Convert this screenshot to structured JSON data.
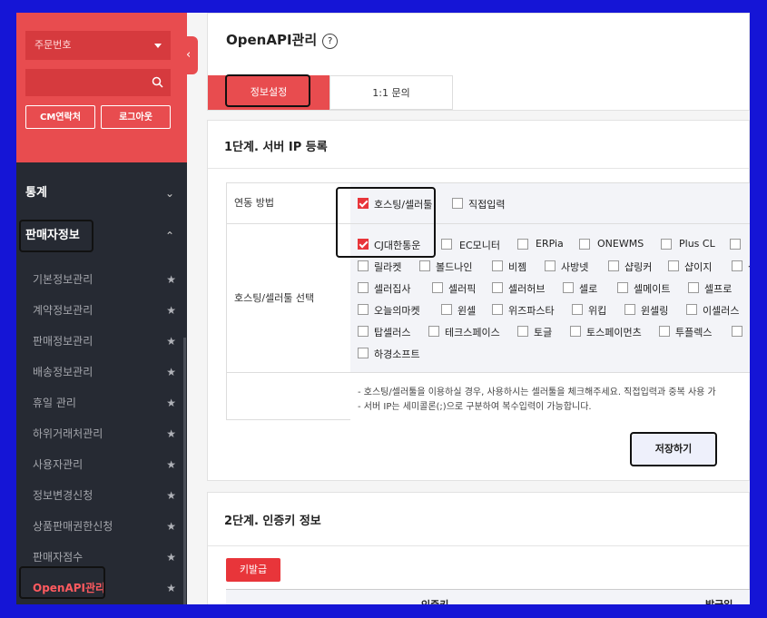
{
  "sidebar": {
    "select_label": "주문번호",
    "contact_button": "CM연락처",
    "logout_button": "로그아웃",
    "sections": [
      {
        "label": "통계",
        "expanded": false
      },
      {
        "label": "판매자정보",
        "expanded": true
      }
    ],
    "items": [
      {
        "label": "기본정보관리"
      },
      {
        "label": "계약정보관리"
      },
      {
        "label": "판매정보관리"
      },
      {
        "label": "배송정보관리"
      },
      {
        "label": "휴일 관리"
      },
      {
        "label": "하위거래처관리"
      },
      {
        "label": "사용자관리"
      },
      {
        "label": "정보변경신청"
      },
      {
        "label": "상품판매권한신청"
      },
      {
        "label": "판매자점수"
      },
      {
        "label": "OpenAPI관리",
        "active": true
      }
    ]
  },
  "header": {
    "title": "OpenAPI관리",
    "help_symbol": "?"
  },
  "tabs": [
    {
      "label": "정보설정",
      "active": true
    },
    {
      "label": "1:1 문의",
      "active": false
    }
  ],
  "step1": {
    "title": "1단계. 서버 IP 등록",
    "link_method_label": "연동 방법",
    "link_methods": [
      {
        "label": "호스팅/셀러툴",
        "checked": true
      },
      {
        "label": "직접입력",
        "checked": false
      }
    ],
    "select_label": "호스팅/셀러툴 선택",
    "tools": [
      [
        {
          "label": "CJ대한통운",
          "checked": true
        },
        {
          "label": "EC모니터"
        },
        {
          "label": "ERPia"
        },
        {
          "label": "ONEWMS"
        },
        {
          "label": "Plus CL"
        },
        {
          "label": "ㅂ"
        }
      ],
      [
        {
          "label": "릴라켓"
        },
        {
          "label": "볼드나인"
        },
        {
          "label": "비젬"
        },
        {
          "label": "사방넷"
        },
        {
          "label": "샵링커"
        },
        {
          "label": "샵이지"
        },
        {
          "label": "샵"
        }
      ],
      [
        {
          "label": "셀러집사"
        },
        {
          "label": "셀러픽"
        },
        {
          "label": "셀러허브"
        },
        {
          "label": "셀로"
        },
        {
          "label": "셀메이트"
        },
        {
          "label": "셀프로"
        }
      ],
      [
        {
          "label": "오늘의마켓"
        },
        {
          "label": "윈셀"
        },
        {
          "label": "위즈파스타"
        },
        {
          "label": "위킵"
        },
        {
          "label": "윈셀링"
        },
        {
          "label": "이셀러스"
        }
      ],
      [
        {
          "label": "탑셀러스"
        },
        {
          "label": "테크스페이스"
        },
        {
          "label": "토글"
        },
        {
          "label": "토스페이먼츠"
        },
        {
          "label": "투플렉스"
        }
      ],
      [
        {
          "label": "하경소프트"
        }
      ]
    ],
    "notes": [
      "- 호스팅/셀러툴을 이용하실 경우, 사용하시는 셀러툴을 체크해주세요. 직접입력과 중복 사용 가",
      "- 서버 IP는 세미콜론(;)으로 구분하여 복수입력이 가능합니다."
    ],
    "save_button": "저장하기"
  },
  "step2": {
    "title": "2단계. 인증키 정보",
    "issue_button": "키발급",
    "columns": [
      "인증키",
      "발급일"
    ]
  },
  "colors": {
    "accent": "#e84c4f",
    "sidebar_bg": "#262a33",
    "active_menu": "#ff5a5f"
  }
}
